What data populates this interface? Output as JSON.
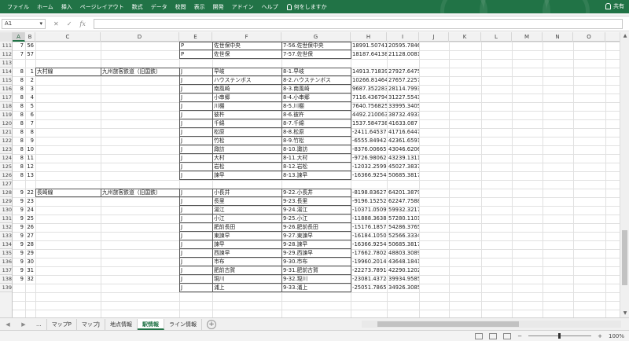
{
  "ribbon": {
    "tabs": [
      "ファイル",
      "ホーム",
      "挿入",
      "ページレイアウト",
      "数式",
      "データ",
      "校閲",
      "表示",
      "開発",
      "アドイン",
      "ヘルプ"
    ],
    "search": "何をしますか",
    "share": "共有"
  },
  "formula_bar": {
    "name_box": "A1",
    "cancel": "✕",
    "enter": "✓",
    "fx": "fx",
    "value": ""
  },
  "columns": [
    "A",
    "B",
    "C",
    "D",
    "E",
    "F",
    "G",
    "H",
    "I",
    "J",
    "K",
    "L",
    "M",
    "N",
    "O"
  ],
  "rows": [
    {
      "n": "111",
      "a": "7",
      "b": "56",
      "c": "",
      "d": "",
      "e": "P",
      "f": "佐世保中央",
      "g": "7-56.佐世保中央",
      "h": "18991.50741",
      "i": "20595.78465"
    },
    {
      "n": "112",
      "a": "7",
      "b": "57",
      "c": "",
      "d": "",
      "e": "P",
      "f": "佐世保",
      "g": "7-57.佐世保",
      "h": "18187.64138",
      "i": "21128.00817"
    },
    {
      "n": "113",
      "a": "",
      "b": "",
      "c": "",
      "d": "",
      "e": "",
      "f": "",
      "g": "",
      "h": "",
      "i": ""
    },
    {
      "n": "114",
      "a": "8",
      "b": "1",
      "c": "大村線",
      "d": "九州旅客鉄道（旧国鉄）",
      "e": "J",
      "f": "早岐",
      "g": "8-1.早岐",
      "h": "14913.71839",
      "i": "27927.64757"
    },
    {
      "n": "115",
      "a": "8",
      "b": "2",
      "c": "",
      "d": "",
      "e": "J",
      "f": "ハウステンボス",
      "g": "8-2.ハウステンボス",
      "h": "10266.81464",
      "i": "27657.22575"
    },
    {
      "n": "116",
      "a": "8",
      "b": "3",
      "c": "",
      "d": "",
      "e": "J",
      "f": "南風崎",
      "g": "8-3.南風崎",
      "h": "9687.352283",
      "i": "28114.79935"
    },
    {
      "n": "117",
      "a": "8",
      "b": "4",
      "c": "",
      "d": "",
      "e": "J",
      "f": "小串郷",
      "g": "8-4.小串郷",
      "h": "7116.436794",
      "i": "31227.55435"
    },
    {
      "n": "118",
      "a": "8",
      "b": "5",
      "c": "",
      "d": "",
      "e": "J",
      "f": "川棚",
      "g": "8-5.川棚",
      "h": "7640.756825",
      "i": "33995.3405"
    },
    {
      "n": "119",
      "a": "8",
      "b": "6",
      "c": "",
      "d": "",
      "e": "J",
      "f": "彼杵",
      "g": "8-6.彼杵",
      "h": "4492.210063",
      "i": "38732.49337"
    },
    {
      "n": "120",
      "a": "8",
      "b": "7",
      "c": "",
      "d": "",
      "e": "J",
      "f": "千綿",
      "g": "8-7.千綿",
      "h": "1537.584738",
      "i": "41633.087"
    },
    {
      "n": "121",
      "a": "8",
      "b": "8",
      "c": "",
      "d": "",
      "e": "J",
      "f": "松原",
      "g": "8-8.松原",
      "h": "-2411.645371",
      "i": "41716.64477"
    },
    {
      "n": "122",
      "a": "8",
      "b": "9",
      "c": "",
      "d": "",
      "e": "J",
      "f": "竹松",
      "g": "8-9.竹松",
      "h": "-6555.849424",
      "i": "42361.65915"
    },
    {
      "n": "123",
      "a": "8",
      "b": "10",
      "c": "",
      "d": "",
      "e": "J",
      "f": "諏訪",
      "g": "8-10.諏訪",
      "h": "-8376.006652",
      "i": "43046.62067"
    },
    {
      "n": "124",
      "a": "8",
      "b": "11",
      "c": "",
      "d": "",
      "e": "J",
      "f": "大村",
      "g": "8-11.大村",
      "h": "-9726.980626",
      "i": "43239.1311"
    },
    {
      "n": "125",
      "a": "8",
      "b": "12",
      "c": "",
      "d": "",
      "e": "J",
      "f": "岩松",
      "g": "8-12.岩松",
      "h": "-12032.25998",
      "i": "45027.3837"
    },
    {
      "n": "126",
      "a": "8",
      "b": "13",
      "c": "",
      "d": "",
      "e": "J",
      "f": "諫早",
      "g": "8-13.諫早",
      "h": "-16366.92545",
      "i": "50685.38172"
    },
    {
      "n": "127",
      "a": "",
      "b": "",
      "c": "",
      "d": "",
      "e": "",
      "f": "",
      "g": "",
      "h": "",
      "i": ""
    },
    {
      "n": "128",
      "a": "9",
      "b": "22",
      "c": "長崎線",
      "d": "九州旅客鉄道（旧国鉄）",
      "e": "J",
      "f": "小長井",
      "g": "9-22.小長井",
      "h": "-8198.836271",
      "i": "64201.38796"
    },
    {
      "n": "129",
      "a": "9",
      "b": "23",
      "c": "",
      "d": "",
      "e": "J",
      "f": "長里",
      "g": "9-23.長里",
      "h": "-9196.152528",
      "i": "62247.75884"
    },
    {
      "n": "130",
      "a": "9",
      "b": "24",
      "c": "",
      "d": "",
      "e": "J",
      "f": "湯江",
      "g": "9-24.湯江",
      "h": "-10371.05099",
      "i": "59932.32178"
    },
    {
      "n": "131",
      "a": "9",
      "b": "25",
      "c": "",
      "d": "",
      "e": "J",
      "f": "小江",
      "g": "9-25.小江",
      "h": "-11888.36383",
      "i": "57280.11016"
    },
    {
      "n": "132",
      "a": "9",
      "b": "26",
      "c": "",
      "d": "",
      "e": "J",
      "f": "肥前長田",
      "g": "9-26.肥前長田",
      "h": "-15176.1857",
      "i": "54286.37657"
    },
    {
      "n": "133",
      "a": "9",
      "b": "27",
      "c": "",
      "d": "",
      "e": "J",
      "f": "東諫早",
      "g": "9-27.東諫早",
      "h": "-16184.10505",
      "i": "52566.33346"
    },
    {
      "n": "134",
      "a": "9",
      "b": "28",
      "c": "",
      "d": "",
      "e": "J",
      "f": "諫早",
      "g": "9-28.諫早",
      "h": "-16366.92545",
      "i": "50685.38172"
    },
    {
      "n": "135",
      "a": "9",
      "b": "29",
      "c": "",
      "d": "",
      "e": "J",
      "f": "西諫早",
      "g": "9-29.西諫早",
      "h": "-17662.78025",
      "i": "48803.30891"
    },
    {
      "n": "136",
      "a": "9",
      "b": "30",
      "c": "",
      "d": "",
      "e": "J",
      "f": "市布",
      "g": "9-30.市布",
      "h": "-19960.20149",
      "i": "43648.18414"
    },
    {
      "n": "137",
      "a": "9",
      "b": "31",
      "c": "",
      "d": "",
      "e": "J",
      "f": "肥前古賀",
      "g": "9-31.肥前古賀",
      "h": "-22273.78914",
      "i": "42290.12028"
    },
    {
      "n": "138",
      "a": "9",
      "b": "32",
      "c": "",
      "d": "",
      "e": "J",
      "f": "現川",
      "g": "9-32.現川",
      "h": "-23081.43724",
      "i": "39934.95859"
    },
    {
      "n": "139",
      "a": "",
      "b": "",
      "c": "",
      "d": "",
      "e": "J",
      "f": "浦上",
      "g": "9-33.浦上",
      "h": "-25051.7865",
      "i": "34926.30852"
    }
  ],
  "sheets": {
    "nav_prev": "◀",
    "nav_next": "▶",
    "more": "...",
    "tabs": [
      "マップP",
      "マップJ",
      "地点情報",
      "駅情報",
      "ライン情報"
    ],
    "active": 3,
    "add": "+"
  },
  "status": {
    "zoom": "100%",
    "minus": "−",
    "plus": "+"
  }
}
